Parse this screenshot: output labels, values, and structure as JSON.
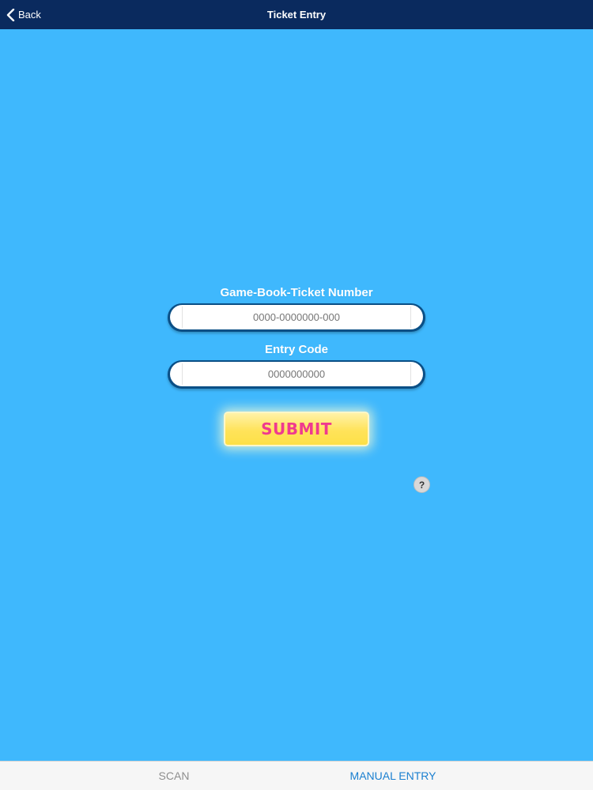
{
  "navbar": {
    "back_label": "Back",
    "title": "Ticket Entry",
    "background": "#0a2a5e"
  },
  "form": {
    "ticket_label": "Game-Book-Ticket Number",
    "ticket_placeholder": "0000-0000000-000",
    "entry_code_label": "Entry Code",
    "entry_code_placeholder": "0000000000",
    "submit_label": "SUBMIT",
    "help_glyph": "?"
  },
  "tabs": [
    {
      "label": "SCAN",
      "selected": false
    },
    {
      "label": "MANUAL ENTRY",
      "selected": true
    }
  ],
  "colors": {
    "page_background": "#3fb8fd",
    "submit_text": "#ef3a8f",
    "submit_fill": "#ffe35a",
    "active_tab": "#1a7fd0",
    "inactive_tab": "#8e8e8e"
  },
  "icons": {
    "back": "chevron-left-icon",
    "help": "question-mark-icon"
  }
}
